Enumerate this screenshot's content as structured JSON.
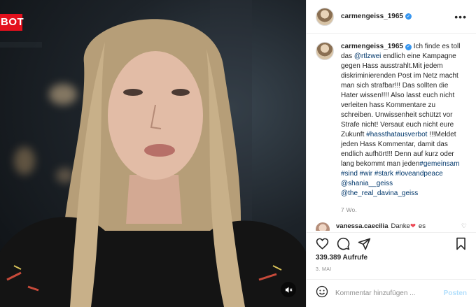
{
  "media": {
    "channel_logo": "BOT",
    "mute_icon": "speaker-muted-icon"
  },
  "post": {
    "username": "carmengeiss_1965",
    "caption": {
      "seg1": " Ich finde es toll das ",
      "mention1": "@rtlzwei",
      "seg2": " endlich eine Kampagne gegen Hass ausstrahlt.Mit jedem diskriminierenden Post im Netz macht man sich strafbar!!! Das sollten die Hater wissen!!!! Also lasst euch nicht verleiten hass Kommentare zu schreiben. Unwissenheit schützt vor Strafe nicht! Versaut euch nicht eure Zukunft ",
      "hashtag1": "#hassthatausverbot",
      "seg3": " !!!Meldet jeden Hass Kommentar, damit das endlich aufhört!!! Denn auf kurz oder lang bekommt man jeden",
      "hashtag2": "#gemeinsam",
      "hashtag3": "#sind",
      "hashtag4": "#wir",
      "hashtag5": "#stark",
      "hashtag6": "#loveandpeace",
      "mention2": "@shania__geiss",
      "mention3": "@the_real_davina_geiss"
    },
    "timestamp": "7 Wo.",
    "comment": {
      "username": "vanessa.caecilia",
      "text": "Danke",
      "heart": "❤",
      "more": "es"
    },
    "views": "339.389 Aufrufe",
    "date": "3. MAI",
    "comment_placeholder": "Kommentar hinzufügen ...",
    "post_label": "Posten"
  },
  "colors": {
    "link": "#00376b",
    "verified": "#3897f0",
    "post_button_disabled": "#b2dffc",
    "channel_logo": "#e3101d"
  }
}
